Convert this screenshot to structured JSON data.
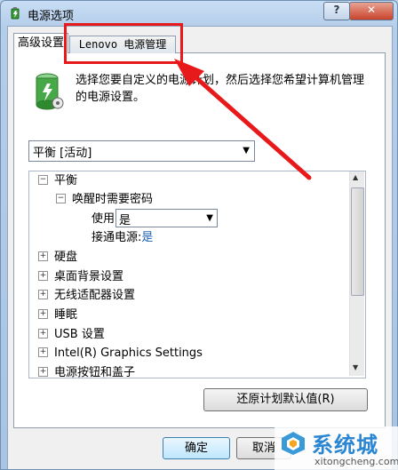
{
  "window": {
    "title": "电源选项",
    "help_label": "?",
    "close_label": "✕"
  },
  "tabs": [
    {
      "label": "高级设置",
      "selected": true
    },
    {
      "label": "Lenovo 电源管理",
      "selected": false
    }
  ],
  "description": "选择您要自定义的电源计划，然后选择您希望计算机管理的电源设置。",
  "plan_select": {
    "value": "平衡 [活动]"
  },
  "tree": {
    "root_label": "平衡",
    "child_label": "唤醒时需要密码",
    "battery_label": "使用电池:",
    "battery_value": "是",
    "plugged_label": "接通电源:",
    "plugged_value": "是",
    "items": [
      "硬盘",
      "桌面背景设置",
      "无线适配器设置",
      "睡眠",
      "USB 设置",
      "Intel(R) Graphics Settings",
      "电源按钮和盖子"
    ]
  },
  "buttons": {
    "restore": "还原计划默认值(R)",
    "ok": "确定",
    "cancel": "取消"
  },
  "watermark": {
    "brand": "系统城",
    "url": "xitongcheng.com"
  },
  "colors": {
    "highlight": "#e8191b",
    "link": "#1a5fb4"
  }
}
